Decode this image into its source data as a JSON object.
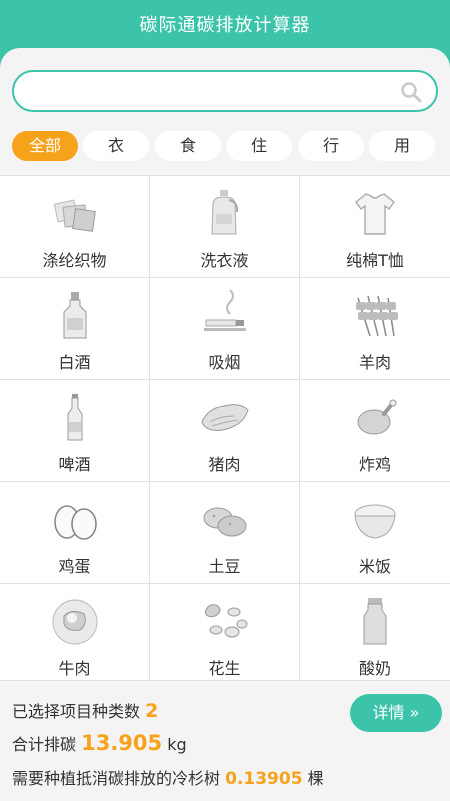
{
  "header": {
    "title": "碳际通碳排放计算器"
  },
  "search": {
    "placeholder": ""
  },
  "tabs": [
    {
      "label": "全部",
      "active": true
    },
    {
      "label": "衣",
      "active": false
    },
    {
      "label": "食",
      "active": false
    },
    {
      "label": "住",
      "active": false
    },
    {
      "label": "行",
      "active": false
    },
    {
      "label": "用",
      "active": false
    }
  ],
  "items": [
    {
      "label": "涤纶织物",
      "icon": "fabric-icon"
    },
    {
      "label": "洗衣液",
      "icon": "detergent-bottle-icon"
    },
    {
      "label": "纯棉T恤",
      "icon": "tshirt-icon"
    },
    {
      "label": "白酒",
      "icon": "liquor-bottle-icon"
    },
    {
      "label": "吸烟",
      "icon": "cigarette-icon"
    },
    {
      "label": "羊肉",
      "icon": "skewer-icon"
    },
    {
      "label": "啤酒",
      "icon": "beer-bottle-icon"
    },
    {
      "label": "猪肉",
      "icon": "pork-icon"
    },
    {
      "label": "炸鸡",
      "icon": "fried-chicken-icon"
    },
    {
      "label": "鸡蛋",
      "icon": "egg-icon"
    },
    {
      "label": "土豆",
      "icon": "potato-icon"
    },
    {
      "label": "米饭",
      "icon": "rice-bowl-icon"
    },
    {
      "label": "牛肉",
      "icon": "beef-icon"
    },
    {
      "label": "花生",
      "icon": "peanut-icon"
    },
    {
      "label": "酸奶",
      "icon": "yogurt-bottle-icon"
    }
  ],
  "summary": {
    "selected_label": "已选择项目种类数",
    "selected_count": "2",
    "total_label": "合计排碳",
    "total_value": "13.905",
    "total_unit": "kg",
    "trees_label": "需要种植抵消碳排放的冷杉树",
    "trees_value": "0.13905",
    "trees_unit": "棵",
    "detail_button": "详情 »"
  },
  "colors": {
    "accent": "#3cc4ab",
    "highlight": "#f7a21b"
  }
}
